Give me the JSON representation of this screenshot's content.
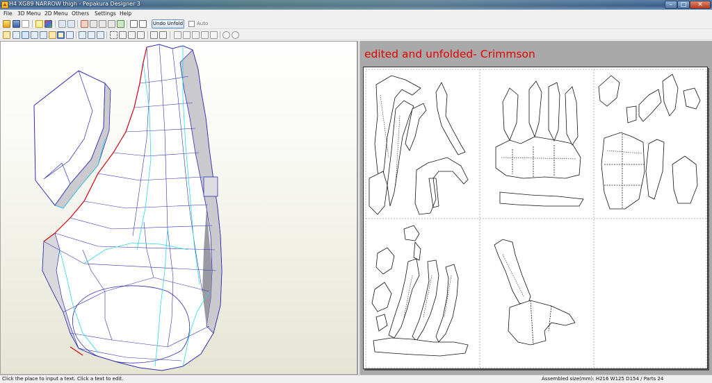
{
  "window": {
    "title": "H4 XG89 NARROW thigh - Pepakura Designer 3",
    "minimize_glyph": "–",
    "maximize_glyph": "□",
    "close_glyph": "✕"
  },
  "menu": [
    {
      "label": "File"
    },
    {
      "label": "3D Menu"
    },
    {
      "label": "2D Menu"
    },
    {
      "label": "Others"
    },
    {
      "label": "Settings"
    },
    {
      "label": "Help"
    }
  ],
  "toolbar": {
    "undo_unfold_label": "Undo Unfold",
    "auto_label": "Auto",
    "auto_checked": false
  },
  "view2d": {
    "heading": "edited and unfolded- Crimmson",
    "heading_color": "#e40000",
    "page_grid": {
      "columns": 3,
      "rows": 2
    }
  },
  "status": {
    "hint": "Click the place to input a text. Click a text to edit.",
    "assembled_size": "Assembled size(mm): H216 W125 D154 / Parts 24"
  },
  "colors": {
    "model_edge": "#2d2db4",
    "fold_line": "#2ad6e6",
    "cut_edge": "#e00000"
  }
}
